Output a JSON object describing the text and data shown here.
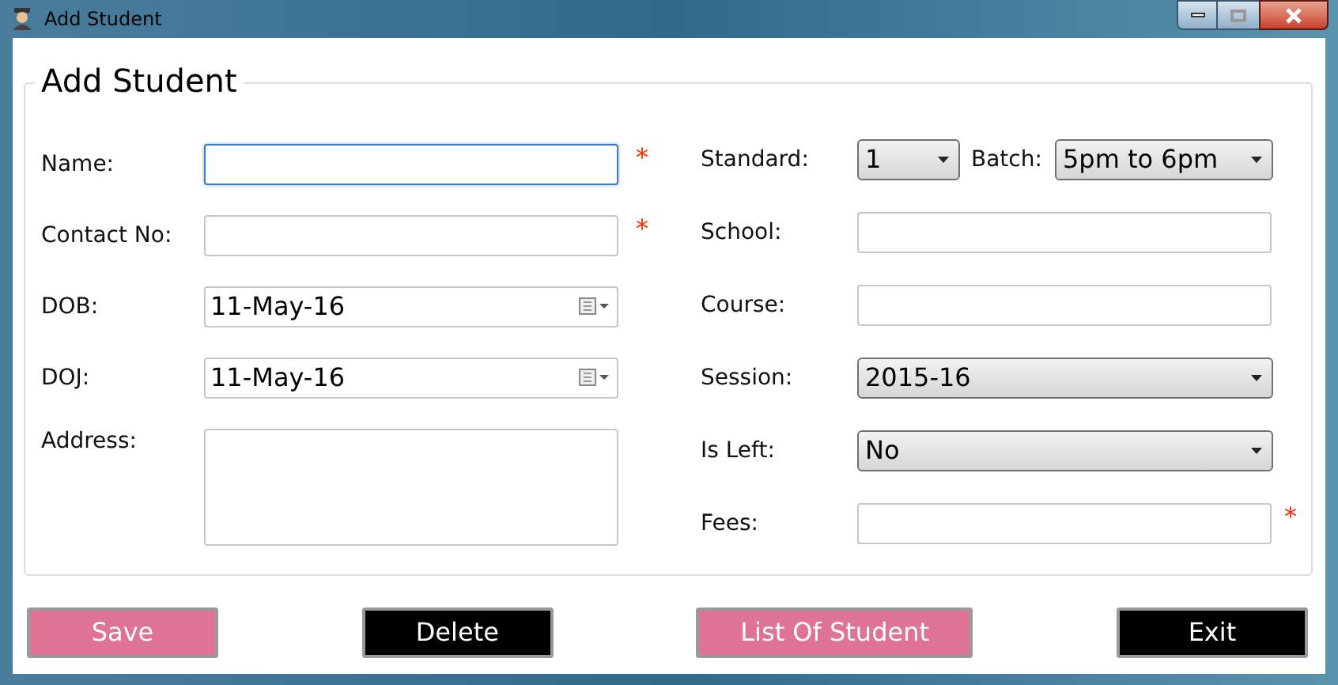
{
  "window": {
    "title": "Add Student"
  },
  "group": {
    "title": "Add Student"
  },
  "left_fields": [
    {
      "label": "Name:",
      "kind": "text",
      "required_mark": "*",
      "focused": true
    },
    {
      "label": "Contact No:",
      "kind": "text",
      "required_mark": "*",
      "focused": false
    },
    {
      "label": "DOB:",
      "kind": "date",
      "value": "11-May-16"
    },
    {
      "label": "DOJ:",
      "kind": "date",
      "value": "11-May-16"
    },
    {
      "label": "Address:",
      "kind": "textarea"
    }
  ],
  "right_fields": [
    {
      "label": "Standard:",
      "kind": "combo_pair",
      "value": "1",
      "second_label": "Batch:",
      "second_value": "5pm to 6pm"
    },
    {
      "label": "School:",
      "kind": "text"
    },
    {
      "label": "Course:",
      "kind": "text"
    },
    {
      "label": "Session:",
      "kind": "combo",
      "value": "2015-16"
    },
    {
      "label": "Is Left:",
      "kind": "combo",
      "value": "No"
    },
    {
      "label": "Fees:",
      "kind": "text",
      "required_mark": "*"
    }
  ],
  "buttons": [
    {
      "label": "Save",
      "kind": "accent"
    },
    {
      "label": "Delete",
      "kind": "dark"
    },
    {
      "label": "List Of Student",
      "kind": "accent"
    },
    {
      "label": "Exit",
      "kind": "dark"
    }
  ]
}
